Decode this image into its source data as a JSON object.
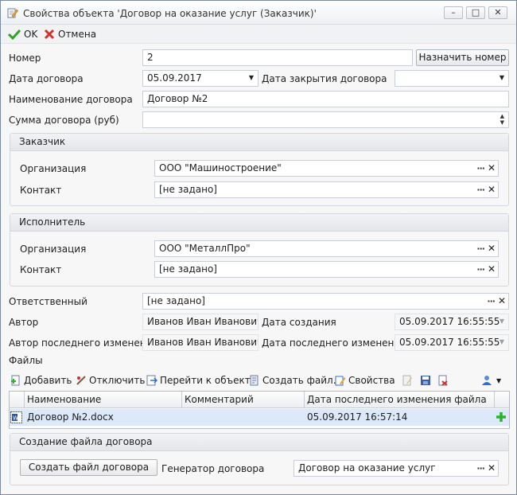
{
  "window": {
    "title": "Свойства объекта 'Договор на оказание услуг (Заказчик)'",
    "controls": {
      "minimize": "–",
      "maximize": "□",
      "close": "✕"
    }
  },
  "toolbar": {
    "ok_label": "OK",
    "cancel_label": "Отмена"
  },
  "form": {
    "number_label": "Номер",
    "number_value": "2",
    "assign_number_button": "Назначить номер",
    "contract_date_label": "Дата договора",
    "contract_date_value": "05.09.2017",
    "close_date_label": "Дата закрытия договора",
    "close_date_value": "",
    "name_label": "Наименование договора",
    "name_value": "Договор №2",
    "sum_label": "Сумма договора (руб)",
    "sum_value": ""
  },
  "customer": {
    "title": "Заказчик",
    "org_label": "Организация",
    "org_value": "ООО \"Машиностроение\"",
    "contact_label": "Контакт",
    "contact_value": "[не задано]"
  },
  "executor": {
    "title": "Исполнитель",
    "org_label": "Организация",
    "org_value": "ООО \"МеталлПро\"",
    "contact_label": "Контакт",
    "contact_value": "[не задано]"
  },
  "meta": {
    "responsible_label": "Ответственный",
    "responsible_value": "[не задано]",
    "author_label": "Автор",
    "author_value": "Иванов Иван Иванович",
    "created_label": "Дата создания",
    "created_value": "05.09.2017 16:55:55",
    "modified_by_label": "Автор последнего изменения",
    "modified_by_value": "Иванов Иван Иванович",
    "modified_label": "Дата последнего изменения",
    "modified_value": "05.09.2017 16:55:55"
  },
  "files": {
    "label": "Файлы",
    "toolbar": {
      "add": "Добавить",
      "detach": "Отключить",
      "goto": "Перейти к объекту",
      "create": "Создать файл...",
      "properties": "Свойства"
    },
    "columns": [
      "Наименование",
      "Комментарий",
      "Дата последнего изменения файла"
    ],
    "rows": [
      {
        "name": "Договор №2.docx",
        "comment": "",
        "modified": "05.09.2017 16:57:14"
      }
    ]
  },
  "create_file": {
    "title": "Создание файла договора",
    "button": "Создать файл договора",
    "generator_label": "Генератор договора",
    "generator_value": "Договор на оказание услуг"
  },
  "colors": {
    "ok_green": "#2fa52f",
    "cancel_red": "#d0312d",
    "selected_row": "#dde8f8",
    "add_plus": "#2bb32b"
  }
}
